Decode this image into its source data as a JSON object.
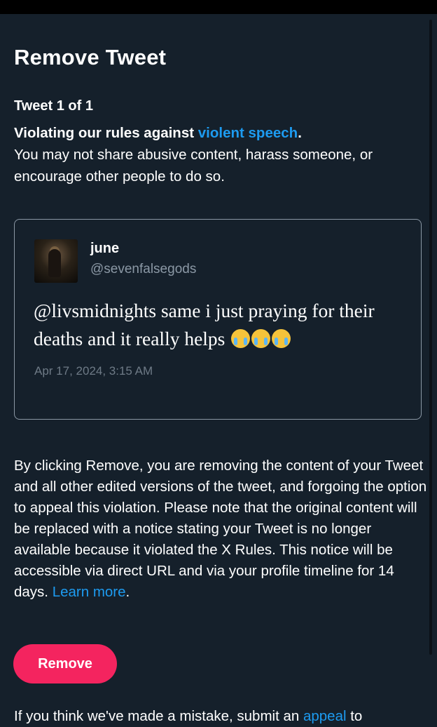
{
  "dialog": {
    "title": "Remove Tweet",
    "count": "Tweet 1 of 1",
    "violation_prefix": "Violating our rules against ",
    "violation_link": "violent speech",
    "violation_suffix": ".",
    "violation_detail": "You may not share abusive content, harass someone, or encourage other people to do so."
  },
  "tweet": {
    "name": "june",
    "handle": "@sevenfalsegods",
    "text": "@livsmidnights same i just praying for their deaths and it really helps",
    "emoji_icon": "loudly-crying-face-icon",
    "emoji_count": 3,
    "timestamp": "Apr 17, 2024, 3:15 AM"
  },
  "disclaimer": {
    "text": "By clicking Remove, you are removing the content of your Tweet and all other edited versions of the tweet, and forgoing the option to appeal this violation. Please note that the original content will be replaced with a notice stating your Tweet is no longer available because it violated the X Rules. This notice will be accessible via direct URL and via your profile timeline for 14 days.",
    "learn_more": "Learn more",
    "learn_more_suffix": "."
  },
  "actions": {
    "remove_label": "Remove"
  },
  "appeal": {
    "prefix": "If you think we've made a mistake, submit an ",
    "link": "appeal",
    "suffix": " to"
  },
  "colors": {
    "background": "#15202b",
    "link": "#1d9bf0",
    "remove_button": "#f4245f",
    "muted_text": "#8b98a5"
  }
}
